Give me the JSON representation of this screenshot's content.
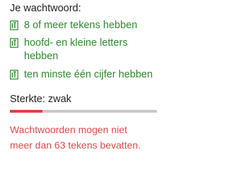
{
  "password_requirements": {
    "heading": "Je wachtwoord:",
    "items": [
      {
        "label": "8 of meer tekens hebben",
        "met": true,
        "icon": "check-icon"
      },
      {
        "label": "hoofd- en kleine letters hebben",
        "met": true,
        "icon": "check-icon"
      },
      {
        "label": "ten minste één cijfer hebben",
        "met": true,
        "icon": "check-icon"
      }
    ]
  },
  "strength": {
    "label": "Sterkte: zwak",
    "level_fraction": 0.22,
    "fill_color": "#e04040",
    "track_color": "#c9c9c9"
  },
  "error_message": "Wachtwoorden mogen niet meer dan 63 tekens bevatten.",
  "colors": {
    "success": "#2e8b2e",
    "error": "#e34a4a"
  }
}
